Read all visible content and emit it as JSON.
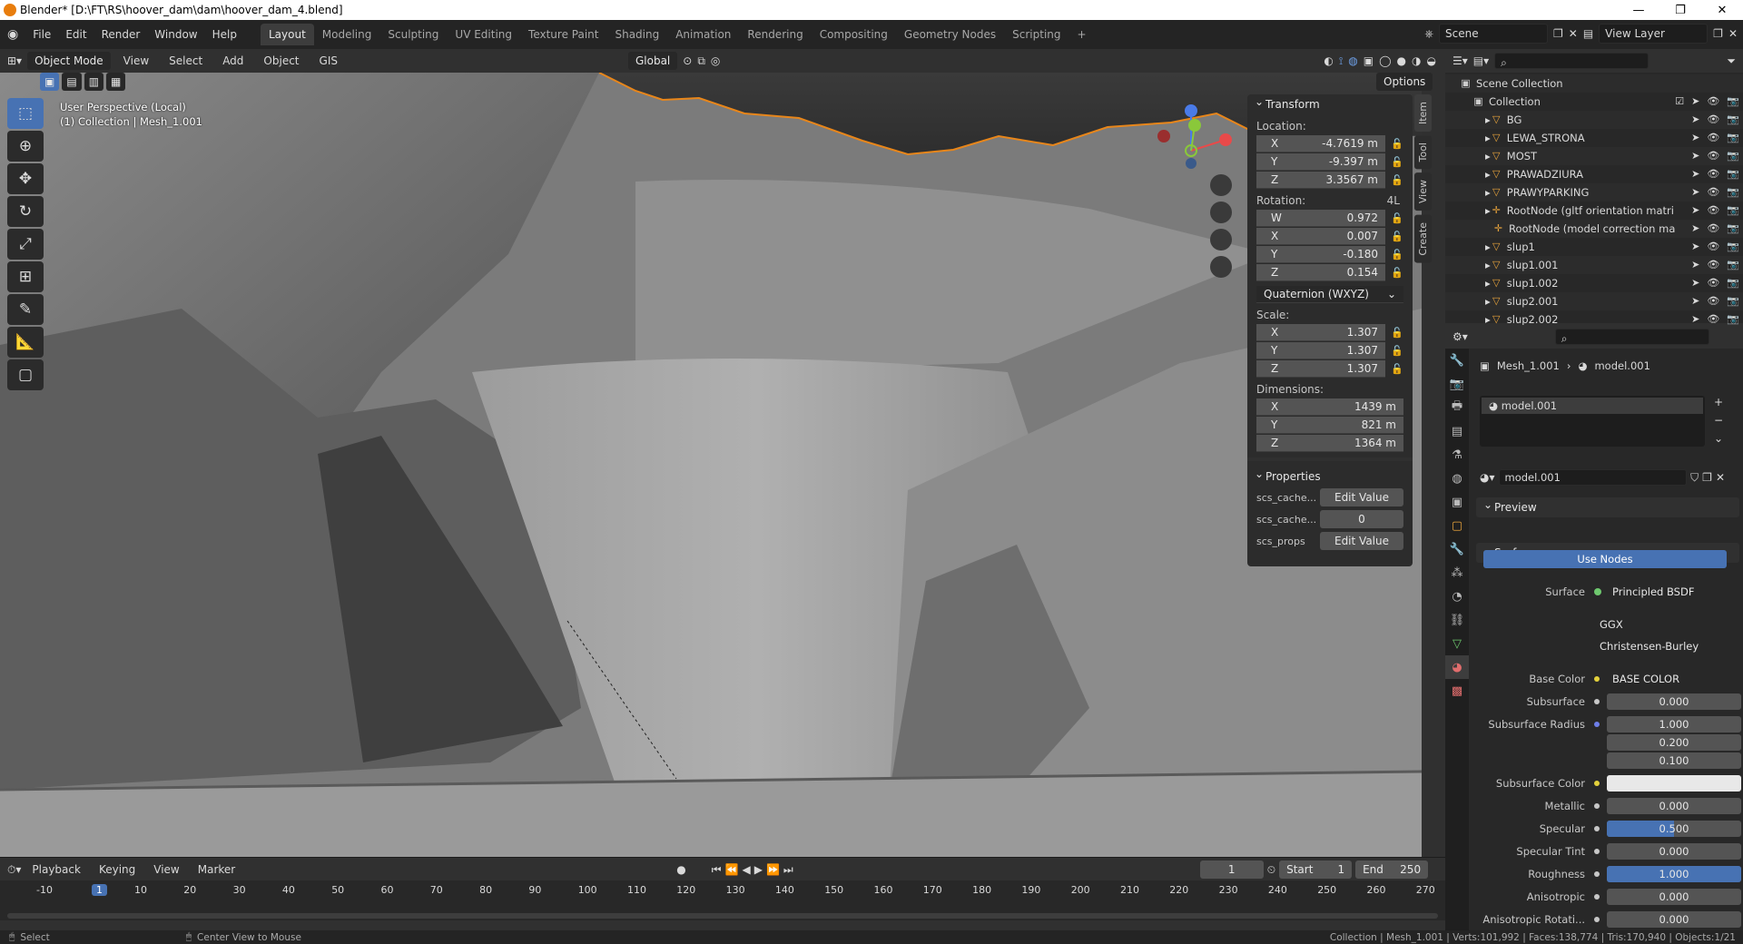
{
  "window": {
    "title": "Blender* [D:\\FT\\RS\\hoover_dam\\dam\\hoover_dam_4.blend]",
    "controls": [
      "—",
      "❐",
      "✕"
    ]
  },
  "menu": [
    "File",
    "Edit",
    "Render",
    "Window",
    "Help"
  ],
  "workspaces": [
    "Layout",
    "Modeling",
    "Sculpting",
    "UV Editing",
    "Texture Paint",
    "Shading",
    "Animation",
    "Rendering",
    "Compositing",
    "Geometry Nodes",
    "Scripting"
  ],
  "active_workspace": "Layout",
  "scene": {
    "scene_name": "Scene",
    "view_layer": "View Layer"
  },
  "viewport_header": {
    "mode": "Object Mode",
    "menus": [
      "View",
      "Select",
      "Add",
      "Object",
      "GIS"
    ],
    "orientation": "Global",
    "options": "Options"
  },
  "viewport_overlay": {
    "line1": "User Perspective (Local)",
    "line2": "(1) Collection | Mesh_1.001"
  },
  "npanel": {
    "tabs": [
      "Item",
      "Tool",
      "View",
      "Create"
    ],
    "transform_title": "Transform",
    "location_label": "Location:",
    "location": [
      {
        "axis": "X",
        "value": "-4.7619 m"
      },
      {
        "axis": "Y",
        "value": "-9.397 m"
      },
      {
        "axis": "Z",
        "value": "3.3567 m"
      }
    ],
    "rotation_label": "Rotation:",
    "rotation_mode_tag": "4L",
    "rotation": [
      {
        "axis": "W",
        "value": "0.972"
      },
      {
        "axis": "X",
        "value": "0.007"
      },
      {
        "axis": "Y",
        "value": "-0.180"
      },
      {
        "axis": "Z",
        "value": "0.154"
      }
    ],
    "rotation_mode": "Quaternion (WXYZ)",
    "scale_label": "Scale:",
    "scale": [
      {
        "axis": "X",
        "value": "1.307"
      },
      {
        "axis": "Y",
        "value": "1.307"
      },
      {
        "axis": "Z",
        "value": "1.307"
      }
    ],
    "dimensions_label": "Dimensions:",
    "dimensions": [
      {
        "axis": "X",
        "value": "1439 m"
      },
      {
        "axis": "Y",
        "value": "821 m"
      },
      {
        "axis": "Z",
        "value": "1364 m"
      }
    ],
    "properties_title": "Properties",
    "properties": [
      {
        "name": "scs_cache...",
        "value": "Edit Value"
      },
      {
        "name": "scs_cache...",
        "value": "0"
      },
      {
        "name": "scs_props",
        "value": "Edit Value"
      }
    ]
  },
  "outliner": {
    "root": "Scene Collection",
    "collection": "Collection",
    "items": [
      "BG",
      "LEWA_STRONA",
      "MOST",
      "PRAWADZIURA",
      "PRAWYPARKING",
      "RootNode (gltf orientation matri",
      "RootNode (model correction ma",
      "slup1",
      "slup1.001",
      "slup1.002",
      "slup2.001",
      "slup2.002"
    ]
  },
  "properties_editor": {
    "breadcrumb_object": "Mesh_1.001",
    "breadcrumb_material": "model.001",
    "slot": "model.001",
    "material_name": "model.001",
    "preview": "Preview",
    "surface_section": "Surface",
    "use_nodes": "Use Nodes",
    "surface_label": "Surface",
    "surface_shader": "Principled BSDF",
    "distribution": "GGX",
    "subsurface_method": "Christensen-Burley",
    "rows": [
      {
        "label": "Base Color",
        "value": "BASE COLOR",
        "fill": 0
      },
      {
        "label": "Subsurface",
        "value": "0.000",
        "fill": 0
      },
      {
        "label": "Subsurface Radius",
        "value": "1.000",
        "fill": 0
      },
      {
        "label": "",
        "value": "0.200",
        "fill": 0
      },
      {
        "label": "",
        "value": "0.100",
        "fill": 0
      },
      {
        "label": "Subsurface Color",
        "value": "",
        "fill": 0
      },
      {
        "label": "Metallic",
        "value": "0.000",
        "fill": 0
      },
      {
        "label": "Specular",
        "value": "0.500",
        "fill": 0.5
      },
      {
        "label": "Specular Tint",
        "value": "0.000",
        "fill": 0
      },
      {
        "label": "Roughness",
        "value": "1.000",
        "fill": 1
      },
      {
        "label": "Anisotropic",
        "value": "0.000",
        "fill": 0
      },
      {
        "label": "Anisotropic Rotati...",
        "value": "0.000",
        "fill": 0
      }
    ]
  },
  "timeline": {
    "menus": [
      "Playback",
      "Keying",
      "View",
      "Marker"
    ],
    "current_frame": "1",
    "start_label": "Start",
    "start": "1",
    "end_label": "End",
    "end": "250",
    "ruler": [
      "-10",
      "1",
      "10",
      "20",
      "30",
      "40",
      "50",
      "60",
      "70",
      "80",
      "90",
      "100",
      "110",
      "120",
      "130",
      "140",
      "150",
      "160",
      "170",
      "180",
      "190",
      "200",
      "210",
      "220",
      "230",
      "240",
      "250",
      "260",
      "270"
    ]
  },
  "status": {
    "left": "Select",
    "middle": "Center View to Mouse",
    "right": "Collection | Mesh_1.001 | Verts:101,992 | Faces:138,774 | Tris:170,940 | Objects:1/21"
  }
}
